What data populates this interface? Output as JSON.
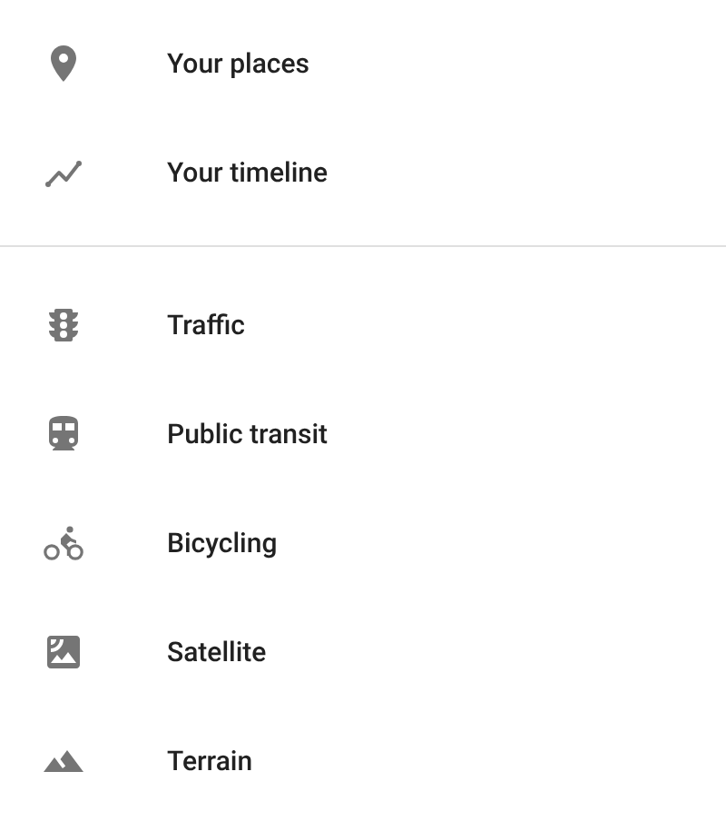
{
  "sections": [
    {
      "items": [
        {
          "label": "Your places"
        },
        {
          "label": "Your timeline"
        }
      ]
    },
    {
      "items": [
        {
          "label": "Traffic"
        },
        {
          "label": "Public transit"
        },
        {
          "label": "Bicycling"
        },
        {
          "label": "Satellite"
        },
        {
          "label": "Terrain"
        }
      ]
    }
  ]
}
